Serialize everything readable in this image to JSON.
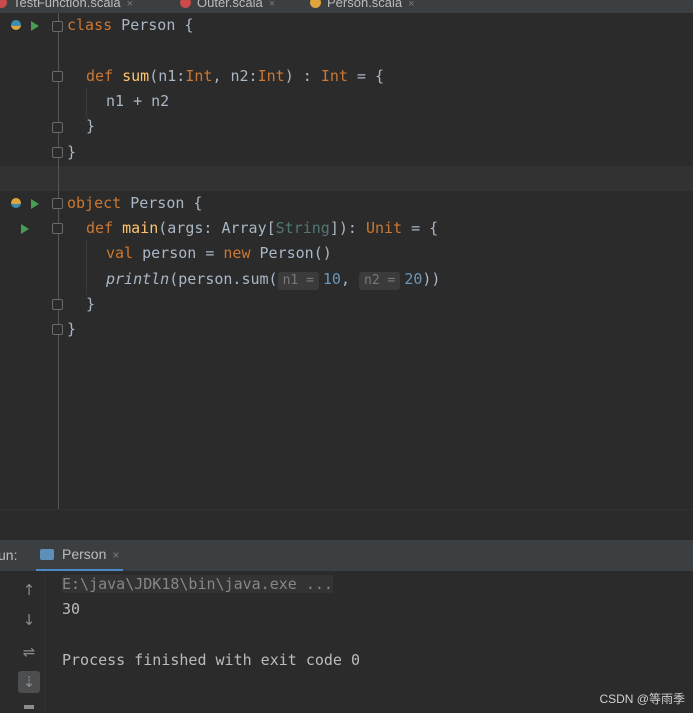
{
  "tabs": [
    {
      "label": "TestFunction.scala",
      "icon": "scala-file-icon",
      "close": "×",
      "active": false
    },
    {
      "label": "Outer.scala",
      "icon": "scala-file-icon",
      "close": "×",
      "active": false
    },
    {
      "label": "Person.scala",
      "icon": "scala-object-icon",
      "close": "×",
      "active": true
    }
  ],
  "code": {
    "l1": {
      "kw": "class",
      "name": " Person {"
    },
    "l2": {
      "kw": "def",
      "fn": "sum",
      "p1": "(n1:",
      "t1": "Int",
      "p2": ", n2:",
      "t2": "Int",
      "p3": ") : ",
      "t3": "Int",
      "p4": " = {"
    },
    "l3": "n1 + n2",
    "l4": "}",
    "l5": "}",
    "l6": {
      "kw": "object",
      "name": " Person {"
    },
    "l7": {
      "kw": "def",
      "fn": "main",
      "p1": "(args: Array[",
      "tp": "String",
      "p2": "]): ",
      "t1": "Unit",
      "p3": " = {"
    },
    "l8": {
      "kw": "val",
      "a": " person = ",
      "kw2": "new",
      "b": " Person()"
    },
    "l9": {
      "fn": "println",
      "a": "(person.sum(",
      "h1": "n1 =",
      "v1": "10",
      "sep": ", ",
      "h2": "n2 =",
      "v2": "20",
      "end": "))"
    },
    "l10": "}",
    "l11": "}"
  },
  "run_panel": {
    "label": "un:",
    "tab": "Person",
    "close": "×",
    "toolbar": {
      "up": "↑",
      "down": "↓",
      "wrap": "⇌",
      "scroll": "⇣"
    }
  },
  "console": {
    "command": "E:\\java\\JDK18\\bin\\java.exe ...",
    "output": "30",
    "exit": "Process finished with exit code 0"
  },
  "watermark": "CSDN @等雨季",
  "colors": {
    "accent": "#4a88c7",
    "keyword": "#cc7832",
    "function": "#ffc66d",
    "number": "#6897bb",
    "run": "#499c54"
  }
}
